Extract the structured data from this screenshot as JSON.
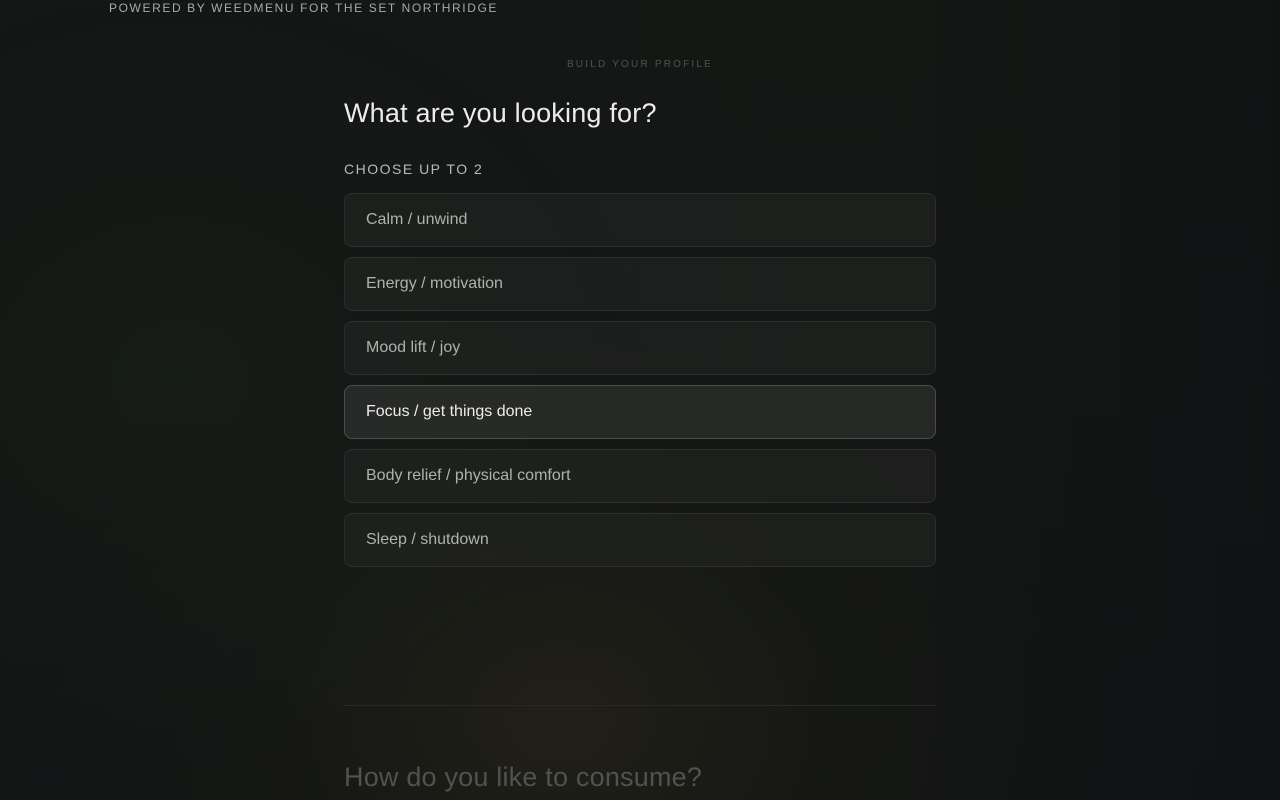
{
  "header": {
    "powered_by": "POWERED BY WEEDMENU FOR THE SET NORTHRIDGE"
  },
  "profile": {
    "eyebrow": "BUILD YOUR PROFILE",
    "question_1": {
      "title": "What are you looking for?",
      "instruction": "CHOOSE UP TO 2",
      "options": [
        {
          "label": "Calm / unwind"
        },
        {
          "label": "Energy / motivation"
        },
        {
          "label": "Mood lift / joy"
        },
        {
          "label": "Focus / get things done"
        },
        {
          "label": "Body relief / physical comfort"
        },
        {
          "label": "Sleep / shutdown"
        }
      ]
    },
    "question_2": {
      "title": "How do you like to consume?"
    }
  }
}
